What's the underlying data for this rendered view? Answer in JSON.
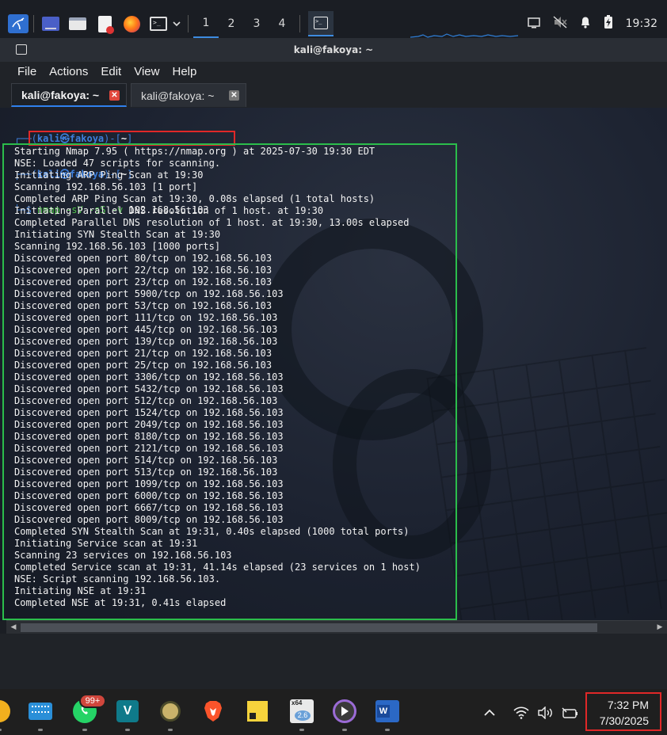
{
  "kali_panel": {
    "workspaces": [
      "1",
      "2",
      "3",
      "4"
    ],
    "active_workspace": "1",
    "clock": "19:32"
  },
  "window": {
    "title": "kali@fakoya: ~"
  },
  "menu": {
    "items": [
      "File",
      "Actions",
      "Edit",
      "View",
      "Help"
    ]
  },
  "tabs": [
    {
      "label": "kali@fakoya: ~",
      "active": true
    },
    {
      "label": "kali@fakoya: ~",
      "active": false
    }
  ],
  "prompt": {
    "line1_open": "┌──(",
    "user_host": "kali㉿fakoya",
    "line1_mid": ")-[",
    "dir": "~",
    "line1_close": "]",
    "line3_prefix": "└─$ ",
    "command_part": "nmap -sV -sS -v",
    "command_arg": " 192.168.56.103"
  },
  "output_lines": [
    "Starting Nmap 7.95 ( https://nmap.org ) at 2025-07-30 19:30 EDT",
    "NSE: Loaded 47 scripts for scanning.",
    "Initiating ARP Ping Scan at 19:30",
    "Scanning 192.168.56.103 [1 port]",
    "Completed ARP Ping Scan at 19:30, 0.08s elapsed (1 total hosts)",
    "Initiating Parallel DNS resolution of 1 host. at 19:30",
    "Completed Parallel DNS resolution of 1 host. at 19:30, 13.00s elapsed",
    "Initiating SYN Stealth Scan at 19:30",
    "Scanning 192.168.56.103 [1000 ports]",
    "Discovered open port 80/tcp on 192.168.56.103",
    "Discovered open port 22/tcp on 192.168.56.103",
    "Discovered open port 23/tcp on 192.168.56.103",
    "Discovered open port 5900/tcp on 192.168.56.103",
    "Discovered open port 53/tcp on 192.168.56.103",
    "Discovered open port 111/tcp on 192.168.56.103",
    "Discovered open port 445/tcp on 192.168.56.103",
    "Discovered open port 139/tcp on 192.168.56.103",
    "Discovered open port 21/tcp on 192.168.56.103",
    "Discovered open port 25/tcp on 192.168.56.103",
    "Discovered open port 3306/tcp on 192.168.56.103",
    "Discovered open port 5432/tcp on 192.168.56.103",
    "Discovered open port 512/tcp on 192.168.56.103",
    "Discovered open port 1524/tcp on 192.168.56.103",
    "Discovered open port 2049/tcp on 192.168.56.103",
    "Discovered open port 8180/tcp on 192.168.56.103",
    "Discovered open port 2121/tcp on 192.168.56.103",
    "Discovered open port 514/tcp on 192.168.56.103",
    "Discovered open port 513/tcp on 192.168.56.103",
    "Discovered open port 1099/tcp on 192.168.56.103",
    "Discovered open port 6000/tcp on 192.168.56.103",
    "Discovered open port 6667/tcp on 192.168.56.103",
    "Discovered open port 8009/tcp on 192.168.56.103",
    "Completed SYN Stealth Scan at 19:31, 0.40s elapsed (1000 total ports)",
    "Initiating Service scan at 19:31",
    "Scanning 23 services on 192.168.56.103",
    "Completed Service scan at 19:31, 41.14s elapsed (23 services on 1 host)",
    "NSE: Script scanning 192.168.56.103.",
    "Initiating NSE at 19:31",
    "Completed NSE at 19:31, 0.41s elapsed"
  ],
  "windows_taskbar": {
    "whatsapp_badge": "99+",
    "vbox_version": "2.6",
    "x64_label": "x64",
    "time": "7:32 PM",
    "date": "7/30/2025"
  },
  "colors": {
    "accent_blue": "#3d7fdb",
    "prompt_green": "#4fc34a",
    "annotation_red": "#e02828",
    "annotation_green": "#2bbd4b"
  }
}
